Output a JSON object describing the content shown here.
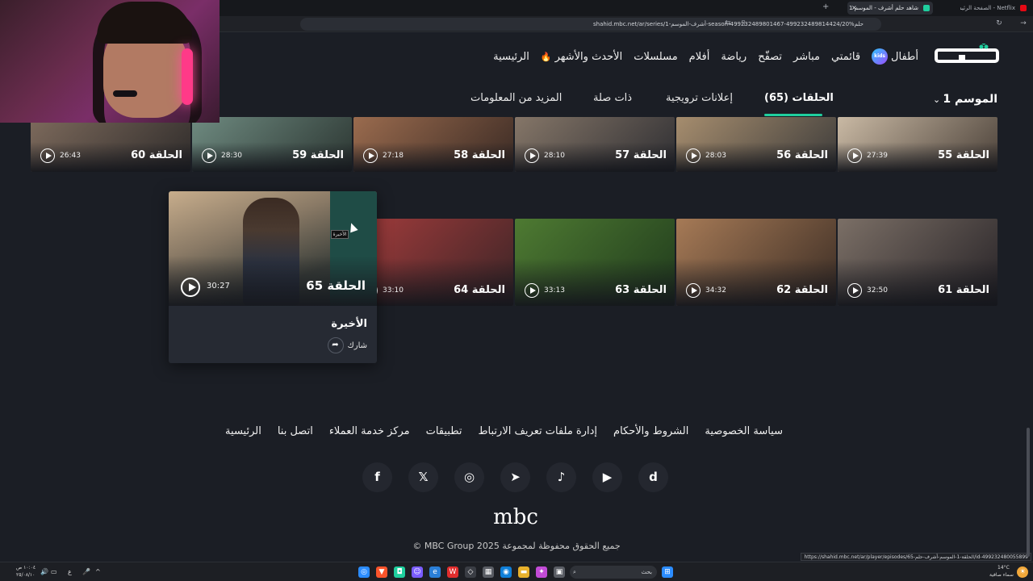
{
  "browser": {
    "tabs": [
      {
        "label": "Netflix - الصفحة الرئيسية",
        "favicon_color": "#e50914"
      },
      {
        "label": "شاهد حلم أشرف - الموسم 1 | net.",
        "favicon_color": "#1fcf9e"
      }
    ],
    "new_tab": "+",
    "close_tab": "×",
    "url": "shahid.mbc.net/ar/series/1-أشرف-الموسم-season-499232489801467-499232489814424/حلم%20"
  },
  "header": {
    "logo_text": "شاهد",
    "nav": [
      "الرئيسية",
      "الأحدث والأشهر",
      "مسلسلات",
      "أفلام",
      "رياضة",
      "تصفّح",
      "مباشر",
      "قائمتي",
      "أطفال"
    ],
    "kids_badge": "kids"
  },
  "season": {
    "label": "الموسم 1"
  },
  "tabs": [
    {
      "label": "الحلقات (65)",
      "active": true
    },
    {
      "label": "إعلانات ترويجية",
      "active": false
    },
    {
      "label": "ذات صلة",
      "active": false
    },
    {
      "label": "المزيد من المعلومات",
      "active": false
    }
  ],
  "episodes_row1": [
    {
      "title": "الحلقة 55",
      "duration": "27:39",
      "c1": "#c9b9a4",
      "c2": "#4a4038"
    },
    {
      "title": "الحلقة 56",
      "duration": "28:03",
      "c1": "#a68d6e",
      "c2": "#3c3b3a"
    },
    {
      "title": "الحلقة 57",
      "duration": "28:10",
      "c1": "#857668",
      "c2": "#2e2e32"
    },
    {
      "title": "الحلقة 58",
      "duration": "27:18",
      "c1": "#9a6b4e",
      "c2": "#3a2a24"
    },
    {
      "title": "الحلقة 59",
      "duration": "28:30",
      "c1": "#6e8a80",
      "c2": "#2b3531"
    },
    {
      "title": "الحلقة 60",
      "duration": "26:43",
      "c1": "#7d6a5c",
      "c2": "#2e2b2a"
    }
  ],
  "episodes_row2": [
    {
      "title": "الحلقة 61",
      "duration": "32:50",
      "c1": "#7b6f66",
      "c2": "#262226"
    },
    {
      "title": "الحلقة 62",
      "duration": "34:32",
      "c1": "#a67a56",
      "c2": "#3a2c24"
    },
    {
      "title": "الحلقة 63",
      "duration": "33:13",
      "c1": "#4e7a32",
      "c2": "#1f3a1c"
    },
    {
      "title": "الحلقة 64",
      "duration": "33:10",
      "c1": "#a33c3c",
      "c2": "#3a2426"
    }
  ],
  "featured": {
    "title": "الحلقة 65",
    "duration": "30:27",
    "subtitle": "الأخيرة",
    "share_label": "شارك",
    "tooltip": "الأخيرة"
  },
  "footer": {
    "links": [
      "الرئيسية",
      "اتصل بنا",
      "مركز خدمة العملاء",
      "تطبيقات",
      "إدارة ملفات تعريف الارتباط",
      "الشروط والأحكام",
      "سياسة الخصوصية"
    ],
    "socials": [
      {
        "name": "facebook-icon",
        "glyph": "f"
      },
      {
        "name": "x-icon",
        "glyph": "𝕏"
      },
      {
        "name": "instagram-icon",
        "glyph": "◎"
      },
      {
        "name": "telegram-icon",
        "glyph": "➤"
      },
      {
        "name": "tiktok-icon",
        "glyph": "♪"
      },
      {
        "name": "youtube-icon",
        "glyph": "▶"
      },
      {
        "name": "dailymotion-icon",
        "glyph": "d"
      }
    ],
    "brand": "mbc",
    "copyright": "جميع الحقوق محفوظة لمجموعة MBC Group 2025 ©",
    "status_url": "https://shahid.mbc.net/ar/player/episodes/65-الحلقة-1-الموسم-أشرف-حلم/id-499232480055899"
  },
  "taskbar": {
    "search_placeholder": "بحث",
    "clock_time": "١٠:٠٤ ص",
    "clock_date": "٢٥/٠٨/١٠",
    "weather": "14°C",
    "weather_desc": "سماء صافية",
    "lang": "ع"
  }
}
